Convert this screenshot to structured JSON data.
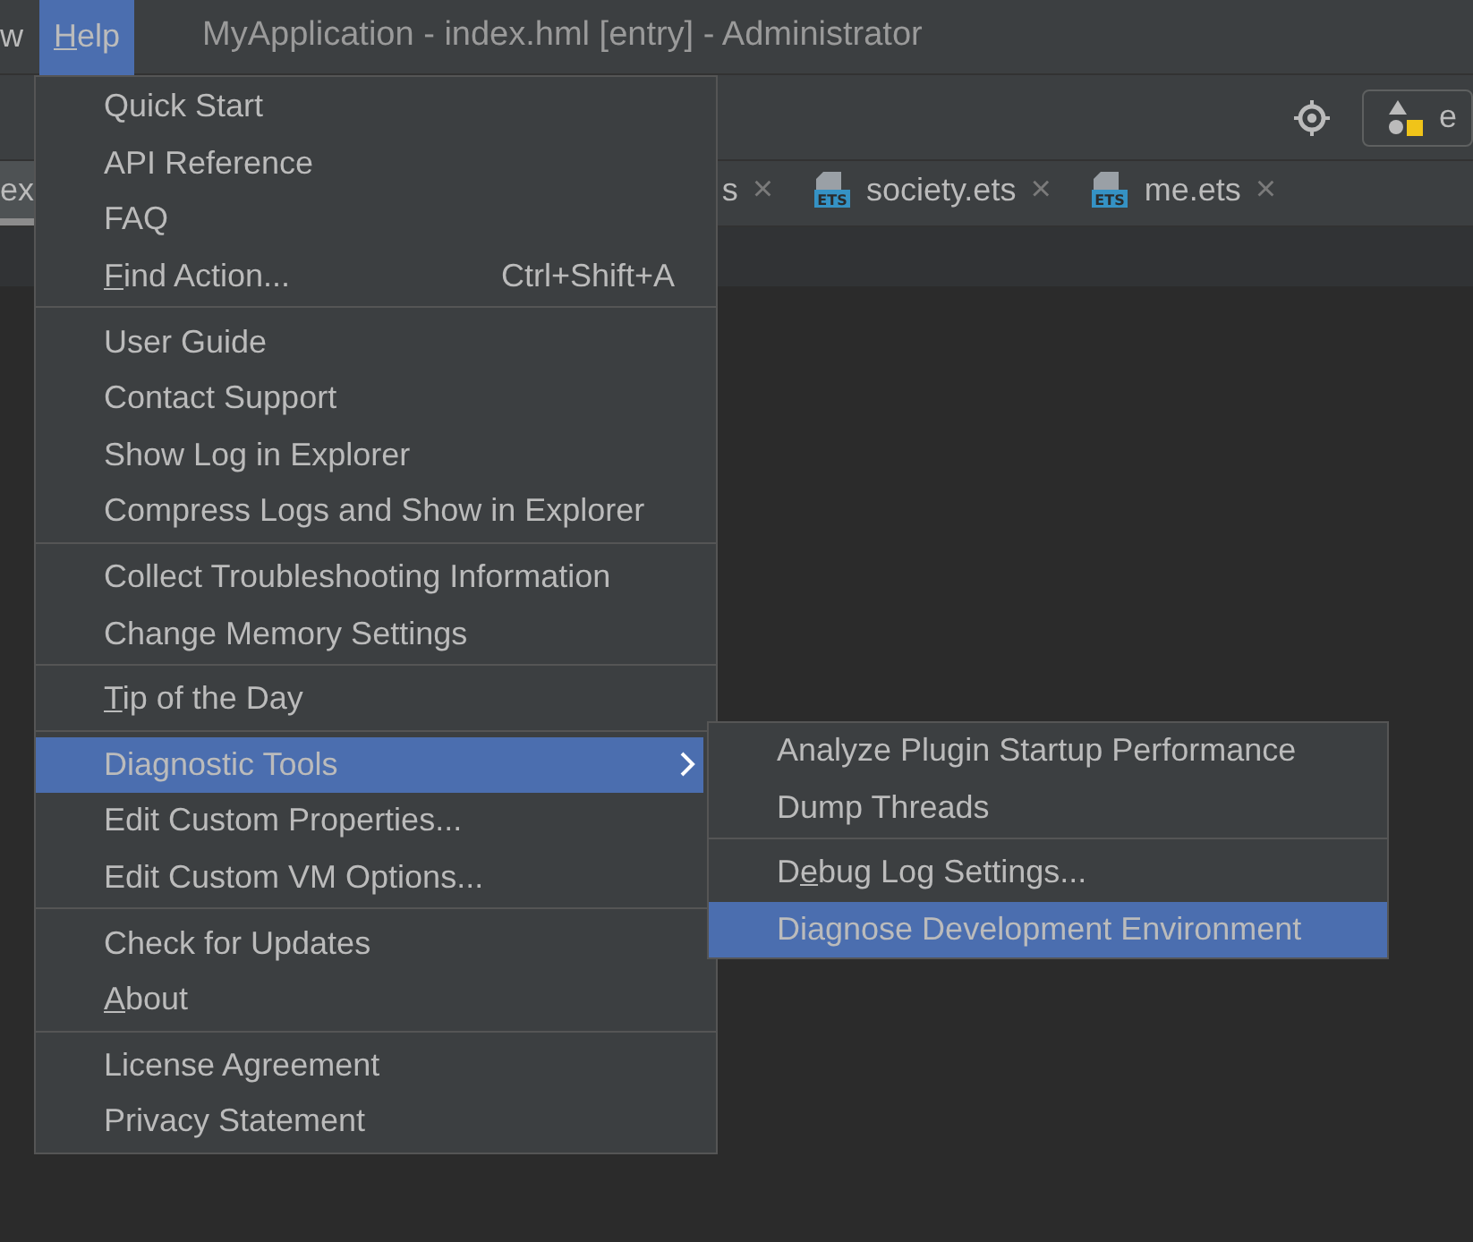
{
  "title_bar": {
    "menus": [
      {
        "label": "w",
        "selected": false
      },
      {
        "mnemonic": "H",
        "label": "elp",
        "selected": true
      }
    ],
    "title": "MyApplication - index.hml [entry] - Administrator"
  },
  "toolbar": {
    "config_button": {
      "label": "e"
    }
  },
  "tabs": [
    {
      "label": "ex",
      "selected": true
    },
    {
      "label": "s",
      "selected": false,
      "close": "×"
    },
    {
      "label": "society.ets",
      "selected": false,
      "close": "×",
      "icon_text": "ETS"
    },
    {
      "label": "me.ets",
      "selected": false,
      "close": "×",
      "icon_text": "ETS"
    }
  ],
  "help_menu": {
    "groups": [
      [
        {
          "label": "Quick Start",
          "selected": false
        },
        {
          "label": "API Reference",
          "selected": false
        },
        {
          "label": "FAQ",
          "selected": false
        },
        {
          "mnemonic": "F",
          "label": "ind Action...",
          "shortcut": "Ctrl+Shift+A",
          "selected": false
        }
      ],
      [
        {
          "label": "User Guide",
          "selected": false
        },
        {
          "label": "Contact Support",
          "selected": false
        },
        {
          "label": "Show Log in Explorer",
          "selected": false
        },
        {
          "label": "Compress Logs and Show in Explorer",
          "selected": false
        }
      ],
      [
        {
          "label": "Collect Troubleshooting Information",
          "selected": false
        },
        {
          "label": "Change Memory Settings",
          "selected": false
        }
      ],
      [
        {
          "mnemonic": "T",
          "label": "ip of the Day",
          "selected": false
        }
      ],
      [
        {
          "label": "Diagnostic Tools",
          "submenu": true,
          "selected": true
        },
        {
          "label": "Edit Custom Properties...",
          "selected": false
        },
        {
          "label": "Edit Custom VM Options...",
          "selected": false
        }
      ],
      [
        {
          "label": "Check for Updates",
          "selected": false
        },
        {
          "mnemonic": "A",
          "label": "bout",
          "selected": false
        }
      ],
      [
        {
          "label": "License Agreement",
          "selected": false
        },
        {
          "label": "Privacy Statement",
          "selected": false
        }
      ]
    ]
  },
  "submenu": {
    "groups": [
      [
        {
          "label": "Analyze Plugin Startup Performance",
          "selected": false
        },
        {
          "label": "Dump Threads",
          "selected": false
        }
      ],
      [
        {
          "label_before": "D",
          "mnemonic": "e",
          "label": "bug Log Settings...",
          "selected": false
        },
        {
          "label": "Diagnose Development Environment",
          "selected": true
        }
      ]
    ]
  }
}
